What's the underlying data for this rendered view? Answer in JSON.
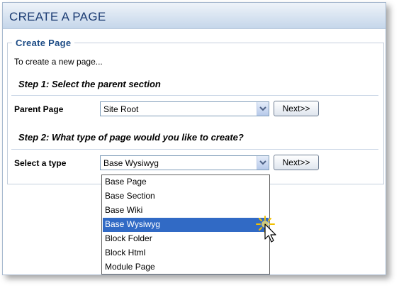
{
  "header": {
    "title": "CREATE A PAGE"
  },
  "panel": {
    "legend": "Create Page",
    "intro": "To create a new page..."
  },
  "step1": {
    "heading": "Step 1: Select the parent section",
    "label": "Parent Page",
    "select_value": "Site Root",
    "next_label": "Next>>"
  },
  "step2": {
    "heading": "Step 2: What type of page would you like to create?",
    "label": "Select a type",
    "select_value": "Base Wysiwyg",
    "next_label": "Next>>"
  },
  "dropdown": {
    "options": [
      "Base Page",
      "Base Section",
      "Base Wiki",
      "Base Wysiwyg",
      "Block Folder",
      "Block Html",
      "Module Page"
    ],
    "selected": "Base Wysiwyg"
  },
  "colors": {
    "accent": "#1c3c73",
    "legend": "#1c4b85",
    "selection": "#316ac5",
    "cursor_glow": "#f2c000"
  },
  "icons": [
    "chevron-down-icon",
    "mouse-cursor-icon"
  ]
}
